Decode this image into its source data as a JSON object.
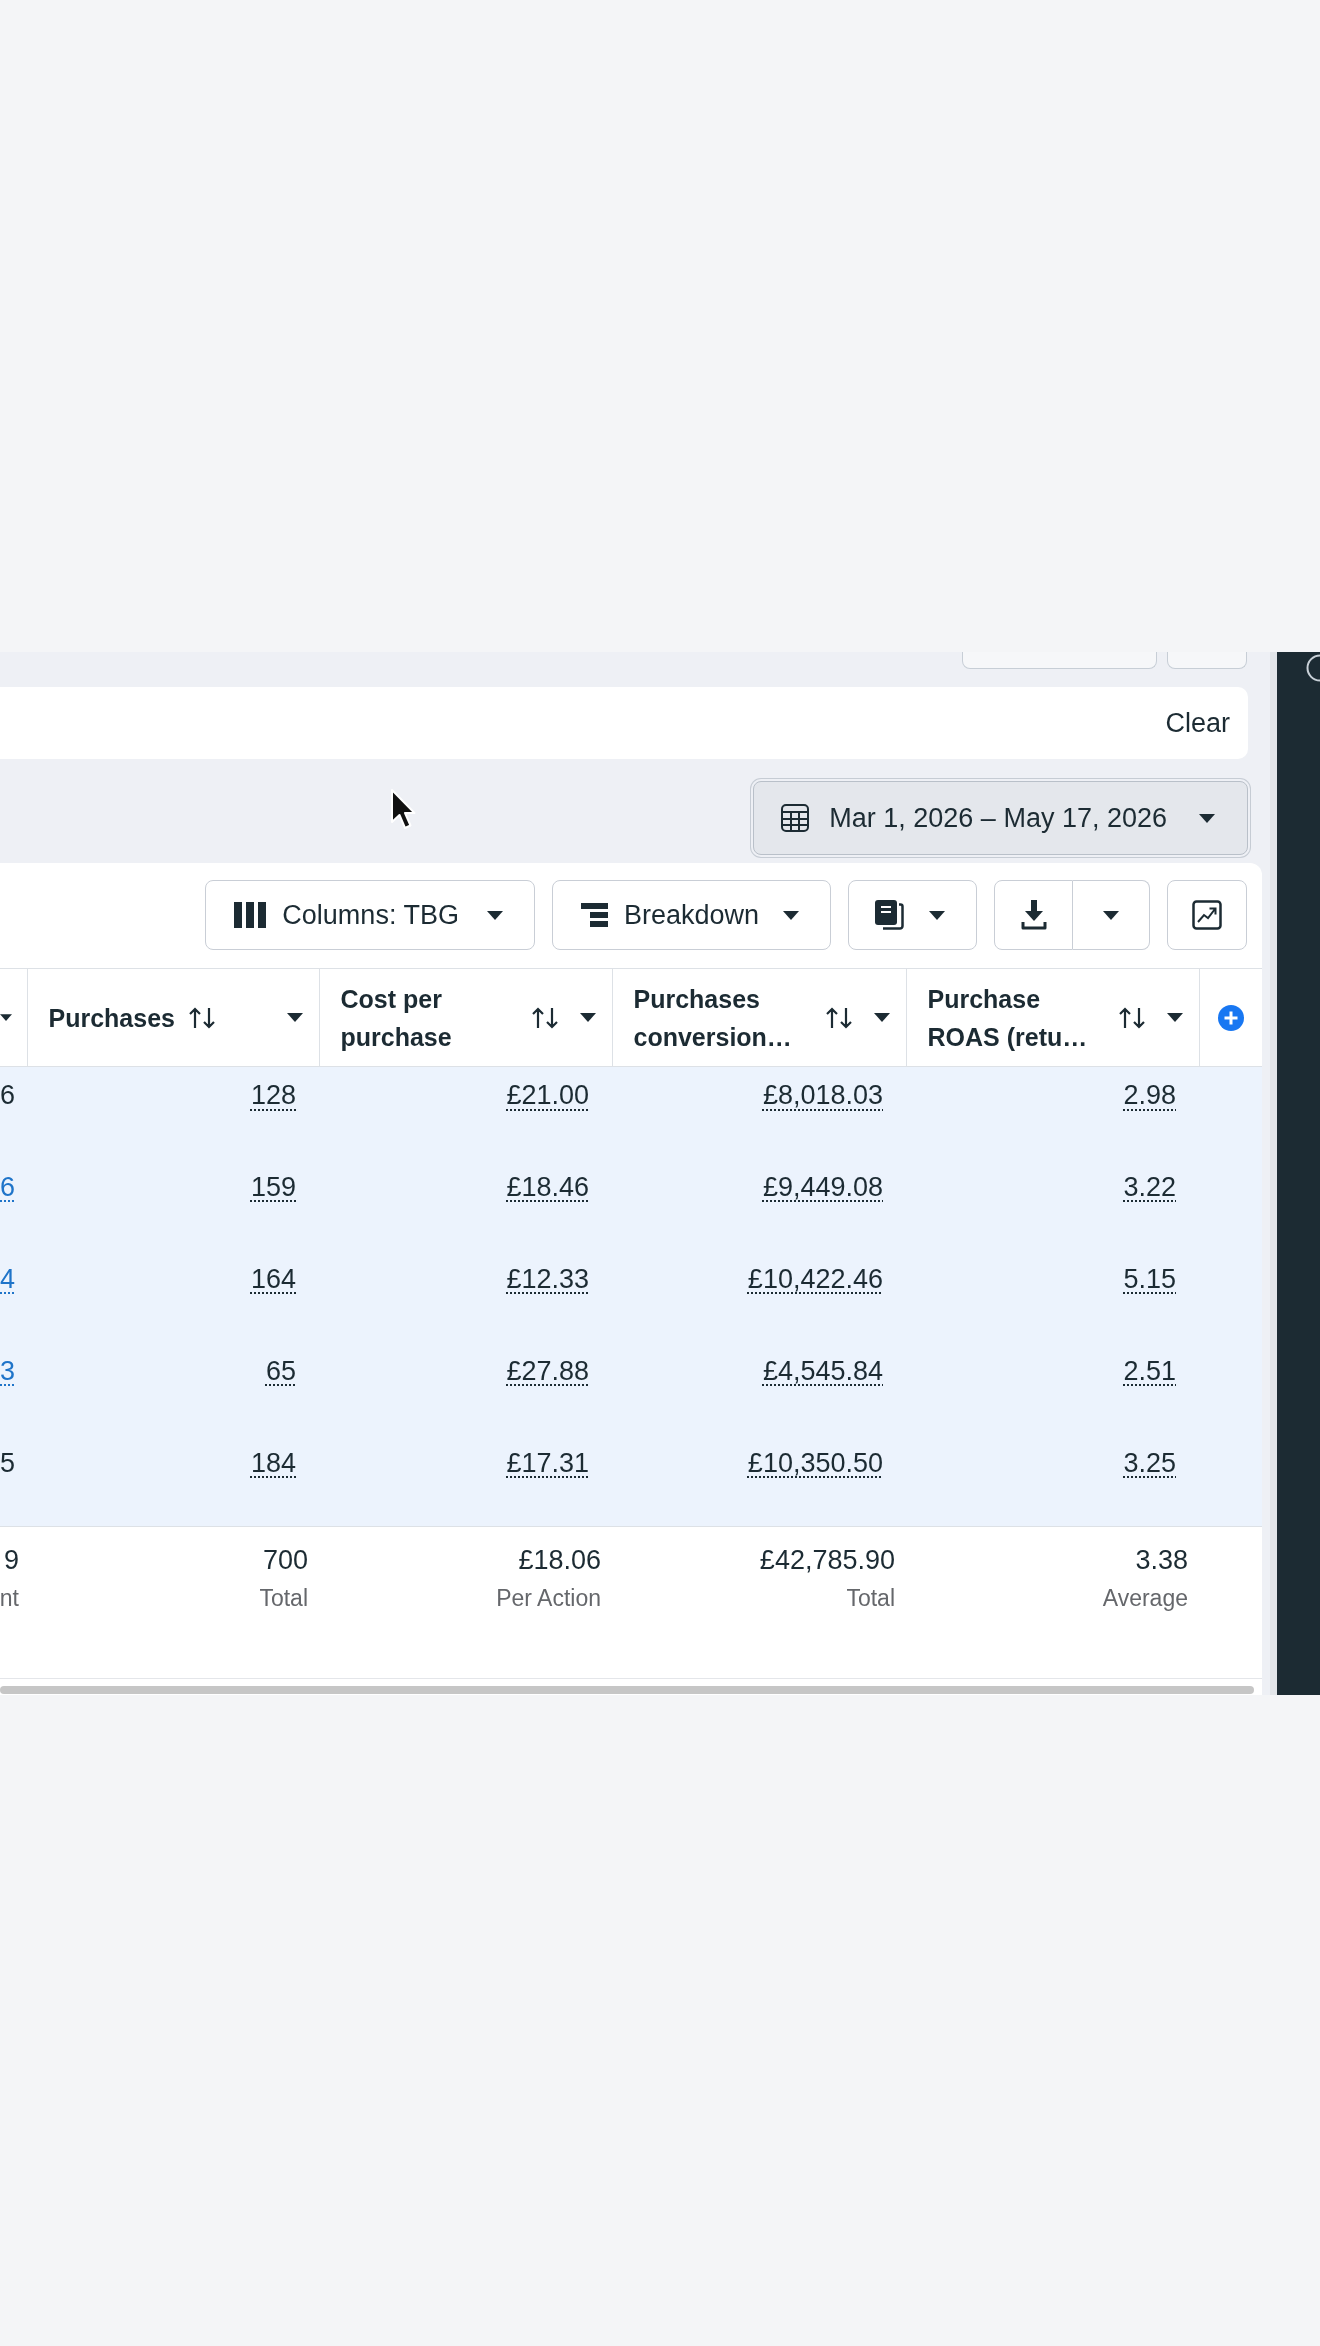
{
  "filter_bar": {
    "clear_label": "Clear"
  },
  "date_range": {
    "label": "Mar 1, 2026 – May 17, 2026"
  },
  "toolbar": {
    "buttons": [
      {
        "kind": "columns",
        "label": "Columns: TBG"
      },
      {
        "kind": "breakdown",
        "label": "Breakdown"
      },
      {
        "kind": "reports"
      },
      {
        "kind": "export"
      },
      {
        "kind": "chart"
      }
    ]
  },
  "table": {
    "columns": [
      {
        "kind": "partial"
      },
      {
        "kind": "metric",
        "label": "Purchases"
      },
      {
        "kind": "metric",
        "label": "Cost per purchase"
      },
      {
        "kind": "metric",
        "label": "Purchases conversion…"
      },
      {
        "kind": "metric",
        "label": "Purchase ROAS (retu…"
      }
    ],
    "rows": [
      {
        "selected": true,
        "first_cell": {
          "text": "6",
          "link": false
        },
        "values": [
          "128",
          "£21.00",
          "£8,018.03",
          "2.98"
        ]
      },
      {
        "selected": true,
        "first_cell": {
          "text": "6",
          "link": true
        },
        "values": [
          "159",
          "£18.46",
          "£9,449.08",
          "3.22"
        ]
      },
      {
        "selected": true,
        "first_cell": {
          "text": "4",
          "link": true
        },
        "values": [
          "164",
          "£12.33",
          "£10,422.46",
          "5.15"
        ]
      },
      {
        "selected": true,
        "first_cell": {
          "text": "3",
          "link": true
        },
        "values": [
          "65",
          "£27.88",
          "£4,545.84",
          "2.51"
        ]
      },
      {
        "selected": true,
        "first_cell": {
          "text": "5",
          "link": false
        },
        "values": [
          "184",
          "£17.31",
          "£10,350.50",
          "3.25"
        ]
      }
    ],
    "totals": [
      {
        "value": "9",
        "label": "nt"
      },
      {
        "value": "700",
        "label": "Total"
      },
      {
        "value": "£18.06",
        "label": "Per Action"
      },
      {
        "value": "£42,785.90",
        "label": "Total"
      },
      {
        "value": "3.38",
        "label": "Average"
      }
    ]
  }
}
